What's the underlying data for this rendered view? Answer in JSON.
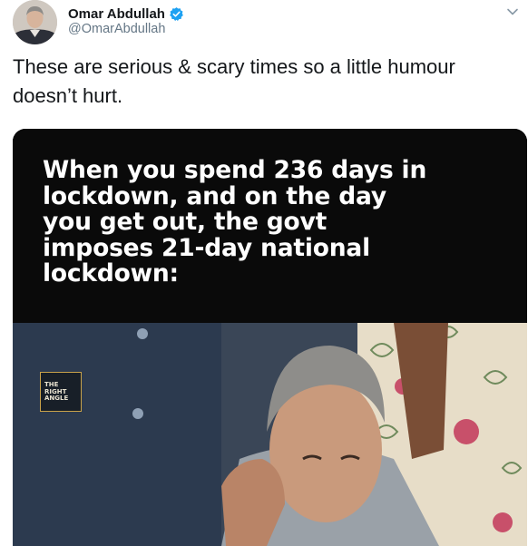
{
  "author": {
    "display_name": "Omar Abdullah",
    "handle": "@OmarAbdullah",
    "verified": true,
    "verified_color": "#1da1f2"
  },
  "tweet": {
    "text": "These are serious & scary times so a little humour doesn’t hurt."
  },
  "media": {
    "caption": "When you spend 236 days in lockdown, and on the day you get out, the govt imposes 21-day national lockdown:",
    "watermark_lines": [
      "THE",
      "RIGHT",
      "ANGLE"
    ]
  },
  "icons": {
    "more": "chevron-down-icon",
    "verified": "verified-badge-icon"
  },
  "colors": {
    "text_primary": "#14171a",
    "text_secondary": "#657786",
    "meme_background": "#0a0a0a"
  }
}
